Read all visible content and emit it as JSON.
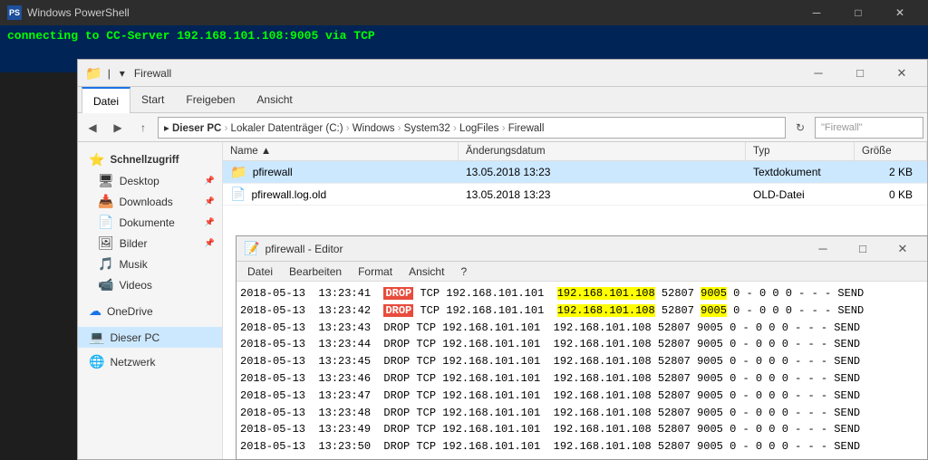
{
  "powershell": {
    "title": "Windows PowerShell",
    "connecting_text": "connecting to CC-Server 192.168.101.108:9005 via TCP"
  },
  "explorer": {
    "title": "Firewall",
    "ribbon_tabs": [
      "Datei",
      "Start",
      "Freigeben",
      "Ansicht"
    ],
    "active_tab": "Datei",
    "address": "Dieser PC > Lokaler Datenträger (C:) > Windows > System32 > LogFiles > Firewall",
    "search_placeholder": "\"Firewall\"",
    "columns": [
      "Name",
      "Änderungsdatum",
      "Typ",
      "Größe"
    ],
    "files": [
      {
        "name": "pfirewall",
        "date": "13.05.2018 13:23",
        "type": "Textdokument",
        "size": "2 KB",
        "selected": true
      },
      {
        "name": "pfirewall.log.old",
        "date": "13.05.2018 13:23",
        "type": "OLD-Datei",
        "size": "0 KB",
        "selected": false
      }
    ],
    "sidebar_items": [
      {
        "label": "Schnellzugriff",
        "icon": "⭐",
        "type": "header"
      },
      {
        "label": "Desktop",
        "icon": "🖥",
        "pin": true
      },
      {
        "label": "Downloads",
        "icon": "📥",
        "pin": true
      },
      {
        "label": "Dokumente",
        "icon": "📄",
        "pin": true
      },
      {
        "label": "Bilder",
        "icon": "🖼",
        "pin": true
      },
      {
        "label": "Musik",
        "icon": "🎵"
      },
      {
        "label": "Videos",
        "icon": "📹"
      },
      {
        "label": "OneDrive",
        "icon": "☁"
      },
      {
        "label": "Dieser PC",
        "icon": "💻",
        "active": true
      },
      {
        "label": "Netzwerk",
        "icon": "🌐"
      }
    ]
  },
  "notepad": {
    "title": "pfirewall - Editor",
    "menu_items": [
      "Datei",
      "Bearbeiten",
      "Format",
      "Ansicht",
      "?"
    ],
    "log_lines": [
      {
        "text": "2018-05-13  13:23:41  DROP  TCP  192.168.101.101  192.168.101.108  52807  9005  0 - 0 0 0 - - - SEND",
        "highlight_ip": true,
        "highlight_port": true
      },
      {
        "text": "2018-05-13  13:23:42  DROP  TCP  192.168.101.101  192.168.101.108  52807  9005  0 - 0 0 0 - - - SEND",
        "highlight_ip": false,
        "highlight_port": false
      },
      {
        "text": "2018-05-13  13:23:43  DROP  TCP  192.168.101.101  192.168.101.108  52807  9005  0 - 0 0 0 - - - SEND",
        "highlight_ip": false,
        "highlight_port": false
      },
      {
        "text": "2018-05-13  13:23:44  DROP  TCP  192.168.101.101  192.168.101.108  52807  9005  0 - 0 0 0 - - - SEND",
        "highlight_ip": false,
        "highlight_port": false
      },
      {
        "text": "2018-05-13  13:23:45  DROP  TCP  192.168.101.101  192.168.101.108  52807  9005  0 - 0 0 0 - - - SEND",
        "highlight_ip": false,
        "highlight_port": false
      },
      {
        "text": "2018-05-13  13:23:46  DROP  TCP  192.168.101.101  192.168.101.108  52807  9005  0 - 0 0 0 - - - SEND",
        "highlight_ip": false,
        "highlight_port": false
      },
      {
        "text": "2018-05-13  13:23:47  DROP  TCP  192.168.101.101  192.168.101.108  52807  9005  0 - 0 0 0 - - - SEND",
        "highlight_ip": false,
        "highlight_port": false
      },
      {
        "text": "2018-05-13  13:23:48  DROP  TCP  192.168.101.101  192.168.101.108  52807  9005  0 - 0 0 0 - - - SEND",
        "highlight_ip": false,
        "highlight_port": false
      },
      {
        "text": "2018-05-13  13:23:49  DROP  TCP  192.168.101.101  192.168.101.108  52807  9005  0 - 0 0 0 - - - SEND",
        "highlight_ip": false,
        "highlight_port": false
      },
      {
        "text": "2018-05-13  13:23:50  DROP  TCP  192.168.101.101  192.168.101.108  52807  9005  0 - 0 0 0 - - - SEND",
        "highlight_ip": false,
        "highlight_port": false
      }
    ]
  }
}
